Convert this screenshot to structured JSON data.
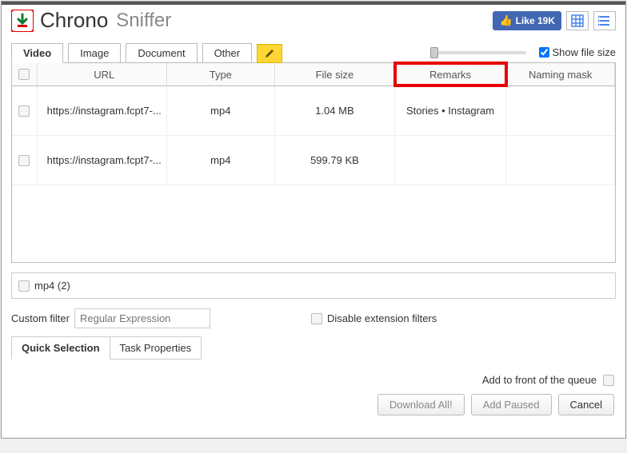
{
  "app": {
    "title_main": "Chrono",
    "title_sub": "Sniffer"
  },
  "header": {
    "like_label": "Like",
    "like_count": "19K",
    "show_file_size": "Show file size"
  },
  "tabs": {
    "video": "Video",
    "image": "Image",
    "document": "Document",
    "other": "Other"
  },
  "columns": {
    "url": "URL",
    "type": "Type",
    "size": "File size",
    "remarks": "Remarks",
    "mask": "Naming mask"
  },
  "rows": [
    {
      "url": "https://instagram.fcpt7-...",
      "type": "mp4",
      "size": "1.04 MB",
      "remarks": "Stories • Instagram",
      "mask": ""
    },
    {
      "url": "https://instagram.fcpt7-...",
      "type": "mp4",
      "size": "599.79 KB",
      "remarks": "",
      "mask": ""
    }
  ],
  "filter_tag": "mp4 (2)",
  "custom_filter": {
    "label": "Custom filter",
    "placeholder": "Regular Expression",
    "disable_label": "Disable extension filters"
  },
  "bottom_tabs": {
    "quick": "Quick Selection",
    "props": "Task Properties"
  },
  "footer": {
    "queue_label": "Add to front of the queue"
  },
  "buttons": {
    "download_all": "Download All!",
    "add_paused": "Add Paused",
    "cancel": "Cancel"
  }
}
